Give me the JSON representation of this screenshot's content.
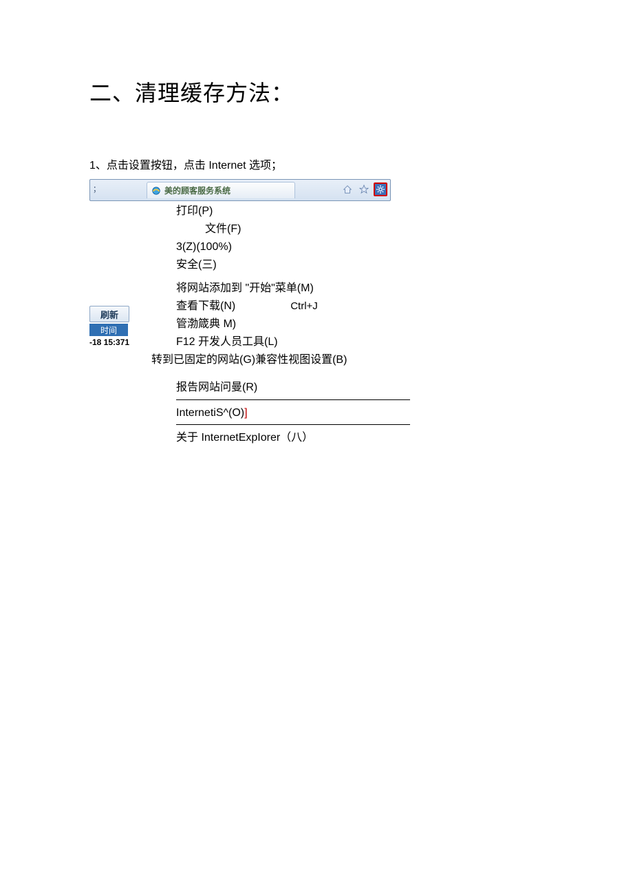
{
  "heading": "二、清理缓存方法：",
  "step1": "1、点击设置按钮，点击 Internet 选项；",
  "toolbar": {
    "left_edge": "；",
    "tab_title": "美的顾客服务系统",
    "icons": {
      "home": "home-icon",
      "star": "star-icon",
      "gear": "gear-icon"
    }
  },
  "left_column": {
    "refresh_label": "刷新",
    "time_label": "时间",
    "timestamp": "-18 15:371"
  },
  "menu": {
    "items": [
      {
        "label": "打印(P)",
        "indent": "indent1"
      },
      {
        "label": "文件(F)",
        "indent": "indent2"
      },
      {
        "label": "3(Z)(100%)",
        "indent": "indent1"
      },
      {
        "label": "安全(三)",
        "indent": "indent1"
      }
    ],
    "group2": [
      {
        "label": "将网站添加到 \"开始\"菜单(M)",
        "indent": "indent1"
      },
      {
        "label": "查看下载(N)",
        "indent": "indent1",
        "shortcut": "Ctrl+J"
      },
      {
        "label": "管渤箴典 M)",
        "indent": "indent1"
      },
      {
        "label": "F12 开发人员工具(L)",
        "indent": "indent1"
      }
    ],
    "pinned": "转到已固定的网站(G)兼容性视图设置(B)",
    "report": "报告网站问曼(R)",
    "options_prefix": "InternetiS^(O)",
    "options_suffix": "]",
    "about": "关于 InternetExpIorer（八）"
  }
}
